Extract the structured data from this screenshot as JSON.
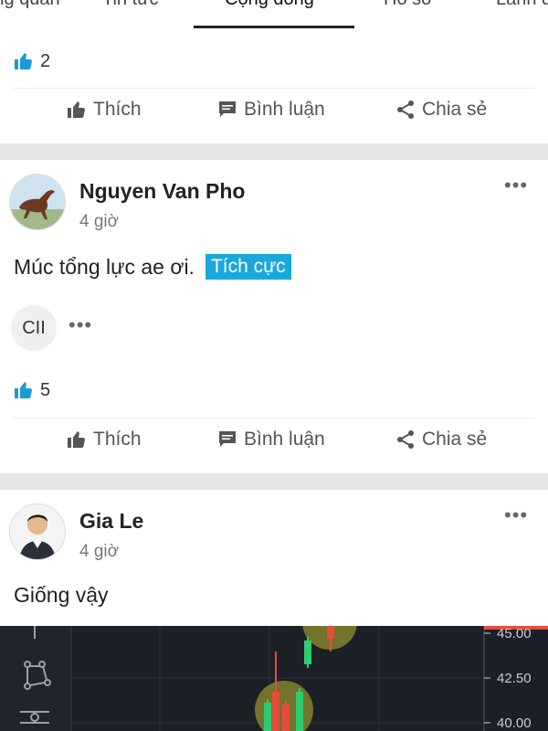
{
  "tabs": [
    {
      "label": "Tổng quan"
    },
    {
      "label": "Tin tức"
    },
    {
      "label": "Cộng đồng",
      "active": true
    },
    {
      "label": "Hồ sơ"
    },
    {
      "label": "Lãnh đạo"
    }
  ],
  "post1": {
    "like_count": "2",
    "actions": {
      "like": "Thích",
      "comment": "Bình luận",
      "share": "Chia sẻ"
    }
  },
  "post2": {
    "author": "Nguyen Van Pho",
    "time": "4 giờ",
    "text": "Múc tổng lực ae ơi.",
    "tag": "Tích cực",
    "ticker": "CII",
    "like_count": "5",
    "actions": {
      "like": "Thích",
      "comment": "Bình luận",
      "share": "Chia sẻ"
    }
  },
  "post3": {
    "author": "Gia Le",
    "time": "4 giờ",
    "text": "Giống vậy",
    "chart_prices": [
      "45.00",
      "42.50",
      "40.00"
    ]
  },
  "colors": {
    "accent": "#19a8de",
    "divider": "#e4e4e4",
    "chart_bg": "#1d1f26",
    "candle_up": "#2ecc71",
    "candle_down": "#e74c3c"
  },
  "icons": {
    "like": "thumbs-up-icon",
    "comment": "comment-icon",
    "share": "share-icon",
    "more": "more-dots-icon"
  }
}
